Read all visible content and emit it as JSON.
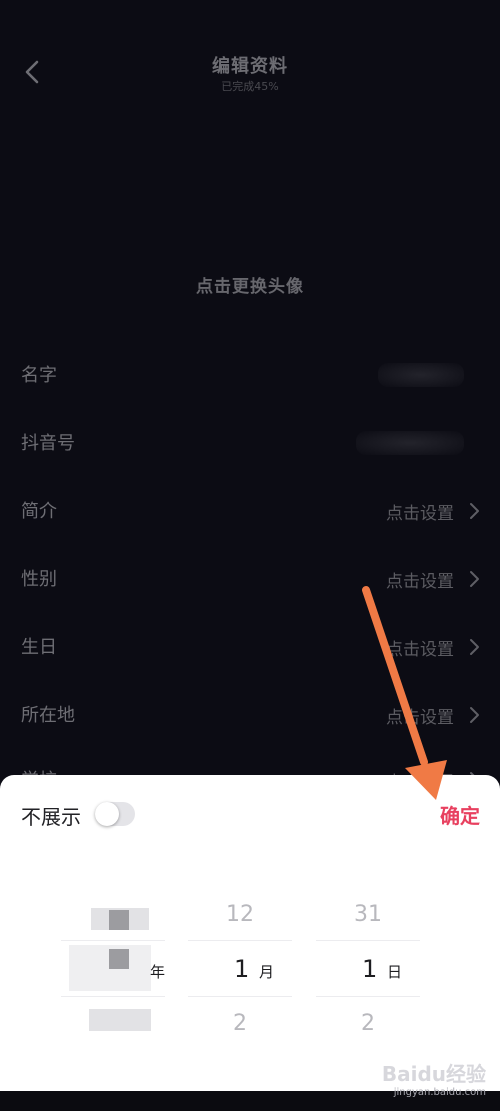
{
  "header": {
    "title": "编辑资料",
    "subtitle": "已完成45%"
  },
  "avatar": {
    "hint": "点击更换头像"
  },
  "fields": {
    "name": {
      "label": "名字"
    },
    "douyin_id": {
      "label": "抖音号"
    },
    "bio": {
      "label": "简介",
      "value": "点击设置"
    },
    "gender": {
      "label": "性别",
      "value": "点击设置"
    },
    "birthday": {
      "label": "生日",
      "value": "点击设置"
    },
    "location": {
      "label": "所在地",
      "value": "点击设置"
    },
    "school": {
      "label": "学校",
      "value": "点击设置"
    }
  },
  "date_picker": {
    "hide_label": "不展示",
    "toggle_on": false,
    "confirm_label": "确定",
    "year": {
      "unit": "年"
    },
    "month": {
      "prev": "12",
      "current": "1",
      "next": "2",
      "unit": "月"
    },
    "day": {
      "prev": "31",
      "current": "1",
      "next": "2",
      "unit": "日"
    }
  },
  "watermark": {
    "logo": "Baidu经验",
    "url": "jingyan.baidu.com"
  },
  "colors": {
    "background": "#0c0c14",
    "sheet": "#ffffff",
    "accent": "#e8405f",
    "arrow": "#f07a45"
  }
}
